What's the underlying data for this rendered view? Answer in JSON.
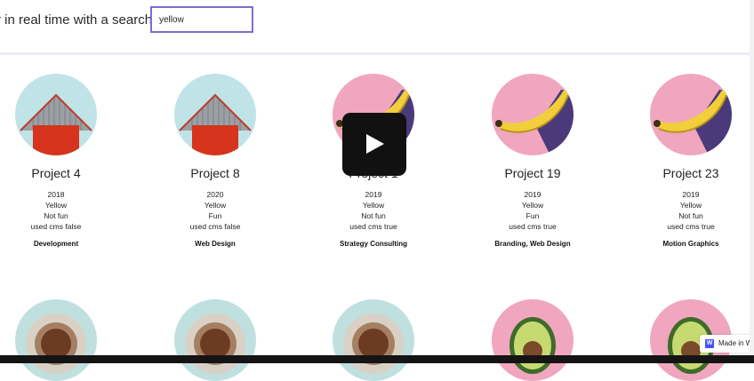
{
  "header": {
    "text": "r in real time with a search bar"
  },
  "search": {
    "value": "yellow"
  },
  "cards_row1": [
    {
      "title": "Project 4",
      "year": "2018",
      "color": "Yellow",
      "fun": "Not fun",
      "cms": "used cms false",
      "category": "Development",
      "image": "barn"
    },
    {
      "title": "Project 8",
      "year": "2020",
      "color": "Yellow",
      "fun": "Fun",
      "cms": "used cms false",
      "category": "Web Design",
      "image": "barn"
    },
    {
      "title": "Project 1",
      "year": "2019",
      "color": "Yellow",
      "fun": "Not fun",
      "cms": "used cms true",
      "category": "Strategy Consulting",
      "image": "banana"
    },
    {
      "title": "Project 19",
      "year": "2019",
      "color": "Yellow",
      "fun": "Fun",
      "cms": "used cms true",
      "category": "Branding, Web Design",
      "image": "banana"
    },
    {
      "title": "Project 23",
      "year": "2019",
      "color": "Yellow",
      "fun": "Not fun",
      "cms": "used cms true",
      "category": "Motion Graphics",
      "image": "banana"
    }
  ],
  "cards_row2": [
    {
      "image": "coffee"
    },
    {
      "image": "coffee"
    },
    {
      "image": "coffee"
    },
    {
      "image": "avocado"
    },
    {
      "image": "avocado"
    }
  ],
  "video": {
    "icon": "play-icon"
  },
  "badge": {
    "text": "Made in W",
    "logo": "W"
  },
  "colors": {
    "accent": "#7b6fd0",
    "barn_bg": "#bfe3e6",
    "banana_bg": "#f0a6be",
    "coffee_bg": "#bfe0df"
  }
}
